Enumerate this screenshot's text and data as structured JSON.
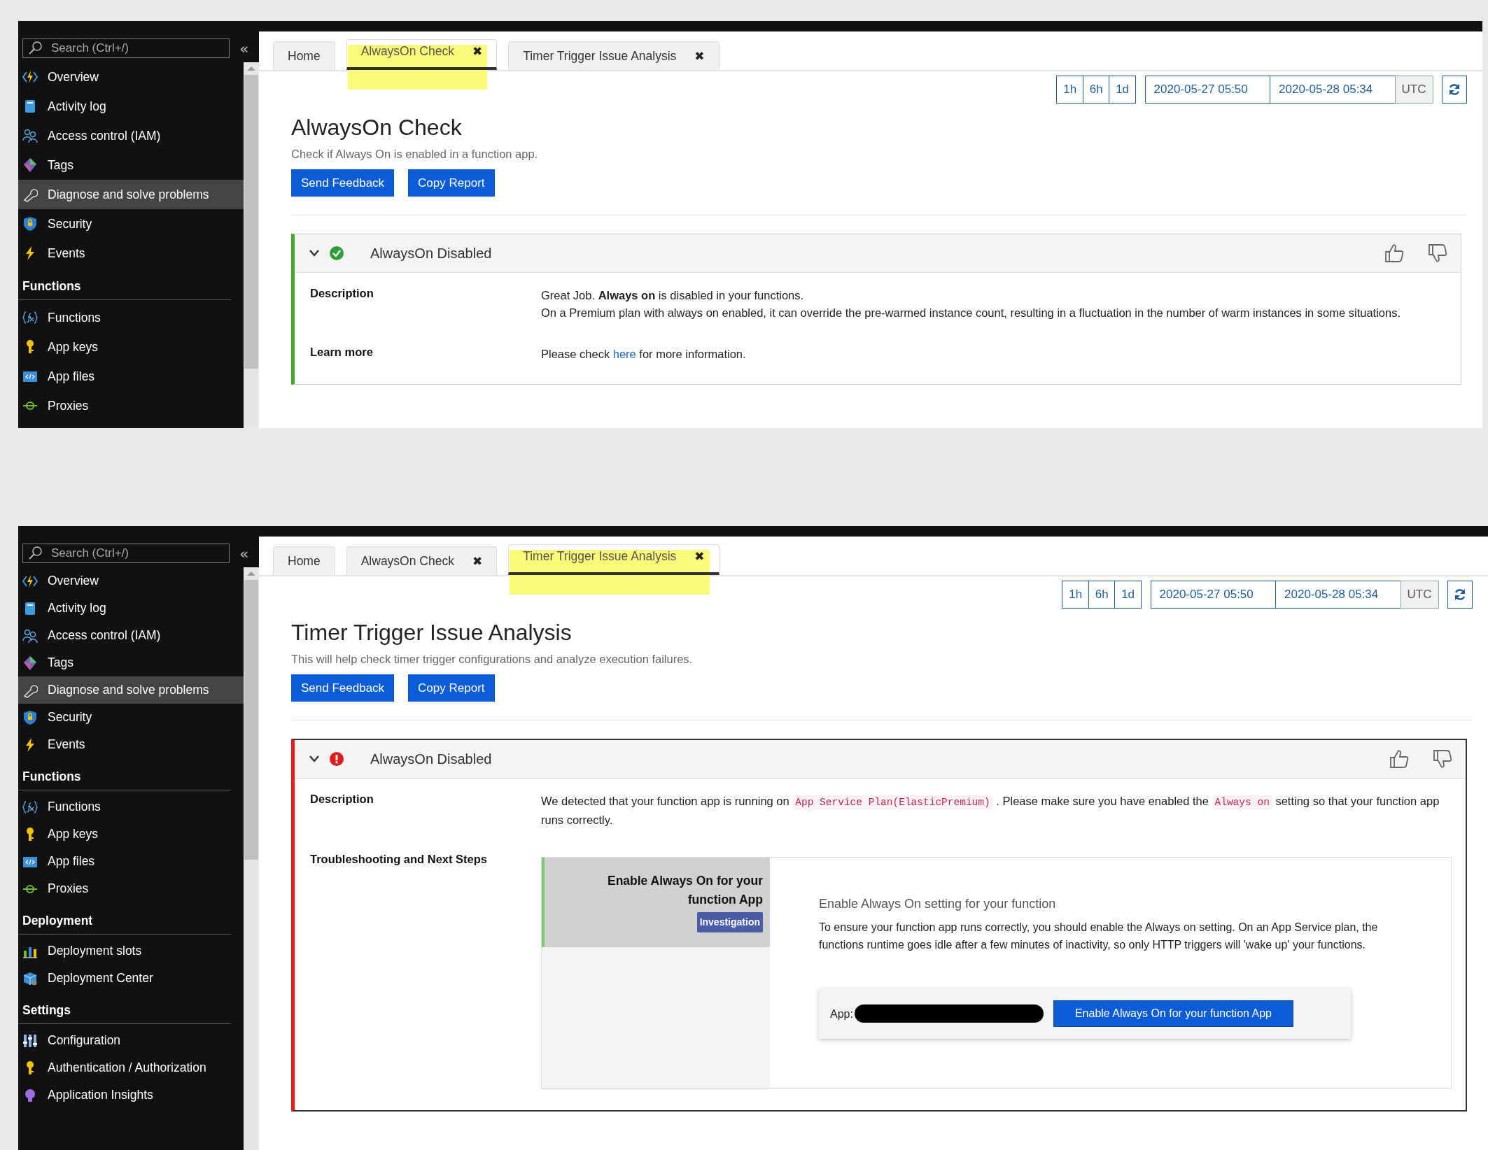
{
  "panels": [
    {
      "sidebar": {
        "search": {
          "placeholder": "Search (Ctrl+/)"
        },
        "collapse": "«",
        "items": [
          {
            "kind": "item",
            "label": "Overview",
            "selected": false
          },
          {
            "kind": "item",
            "label": "Activity log",
            "selected": false
          },
          {
            "kind": "item",
            "label": "Access control (IAM)",
            "selected": false
          },
          {
            "kind": "item",
            "label": "Tags",
            "selected": false
          },
          {
            "kind": "item",
            "label": "Diagnose and solve problems",
            "selected": true
          },
          {
            "kind": "item",
            "label": "Security",
            "selected": false
          },
          {
            "kind": "item",
            "label": "Events",
            "selected": false
          },
          {
            "kind": "heading",
            "label": "Functions"
          },
          {
            "kind": "item",
            "label": "Functions",
            "selected": false
          },
          {
            "kind": "item",
            "label": "App keys",
            "selected": false
          },
          {
            "kind": "item",
            "label": "App files",
            "selected": false
          },
          {
            "kind": "item",
            "label": "Proxies",
            "selected": false
          }
        ]
      },
      "tabs": [
        {
          "label": "Home",
          "selected": false,
          "highlighted": false
        },
        {
          "label": "AlwaysOn Check",
          "close": "✖",
          "selected": true,
          "highlighted": true
        },
        {
          "label": "Timer Trigger Issue Analysis",
          "close": "✖",
          "selected": false,
          "highlighted": false
        }
      ],
      "time_range": {
        "presets": [
          "1h",
          "6h",
          "1d"
        ],
        "start": "2020-05-27 05:50",
        "end": "2020-05-28 05:34",
        "timezone": "UTC"
      },
      "title": "AlwaysOn Check",
      "subtitle": "Check if Always On is enabled in a function app.",
      "buttons": [
        "Send Feedback",
        "Copy Report"
      ],
      "insight": {
        "kind": "success",
        "title": "AlwaysOn Disabled",
        "expanded": true,
        "rows": [
          {
            "kind": "text",
            "label": "Description",
            "lines": [
              [
                {
                  "kind": "text",
                  "text": "Great Job. **Always on** is disabled in your functions."
                }
              ],
              [
                {
                  "kind": "text",
                  "text": "On a Premium plan with always on enabled, it can override the pre-warmed instance count, resulting in a fluctuation in the number of warm instances in some situations."
                }
              ]
            ]
          },
          {
            "kind": "text",
            "label": "Learn more",
            "lines": [
              [
                {
                  "kind": "text",
                  "text": "Please check "
                },
                {
                  "kind": "link",
                  "text": "here"
                },
                {
                  "kind": "text",
                  "text": " for more information."
                }
              ]
            ]
          }
        ]
      }
    },
    {
      "sidebar": {
        "search": {
          "placeholder": "Search (Ctrl+/)"
        },
        "collapse": "«",
        "items": [
          {
            "kind": "item",
            "label": "Overview",
            "selected": false
          },
          {
            "kind": "item",
            "label": "Activity log",
            "selected": false
          },
          {
            "kind": "item",
            "label": "Access control (IAM)",
            "selected": false
          },
          {
            "kind": "item",
            "label": "Tags",
            "selected": false
          },
          {
            "kind": "item",
            "label": "Diagnose and solve problems",
            "selected": true
          },
          {
            "kind": "item",
            "label": "Security",
            "selected": false
          },
          {
            "kind": "item",
            "label": "Events",
            "selected": false
          },
          {
            "kind": "heading",
            "label": "Functions"
          },
          {
            "kind": "item",
            "label": "Functions",
            "selected": false
          },
          {
            "kind": "item",
            "label": "App keys",
            "selected": false
          },
          {
            "kind": "item",
            "label": "App files",
            "selected": false
          },
          {
            "kind": "item",
            "label": "Proxies",
            "selected": false
          },
          {
            "kind": "heading",
            "label": "Deployment"
          },
          {
            "kind": "item",
            "label": "Deployment slots",
            "selected": false
          },
          {
            "kind": "item",
            "label": "Deployment Center",
            "selected": false
          },
          {
            "kind": "heading",
            "label": "Settings"
          },
          {
            "kind": "item",
            "label": "Configuration",
            "selected": false
          },
          {
            "kind": "item",
            "label": "Authentication / Authorization",
            "selected": false
          },
          {
            "kind": "item",
            "label": "Application Insights",
            "selected": false
          }
        ]
      },
      "tabs": [
        {
          "label": "Home",
          "selected": false,
          "highlighted": false
        },
        {
          "label": "AlwaysOn Check",
          "close": "✖",
          "selected": false,
          "highlighted": false
        },
        {
          "label": "Timer Trigger Issue Analysis",
          "close": "✖",
          "selected": true,
          "highlighted": true
        }
      ],
      "time_range": {
        "presets": [
          "1h",
          "6h",
          "1d"
        ],
        "start": "2020-05-27 05:50",
        "end": "2020-05-28 05:34",
        "timezone": "UTC"
      },
      "title": "Timer Trigger Issue Analysis",
      "subtitle": "This will help check timer trigger configurations and analyze execution failures.",
      "buttons": [
        "Send Feedback",
        "Copy Report"
      ],
      "insight": {
        "kind": "critical",
        "title": "AlwaysOn Disabled",
        "expanded": true,
        "rows": [
          {
            "kind": "text",
            "label": "Description",
            "lines": [
              [
                {
                  "kind": "text",
                  "text": "We detected that your function app is running on "
                },
                {
                  "kind": "code",
                  "text": "App Service Plan(ElasticPremium)"
                },
                {
                  "kind": "text",
                  "text": " . Please make sure you have enabled the "
                },
                {
                  "kind": "code",
                  "text": "Always on"
                },
                {
                  "kind": "text",
                  "text": " setting so that your function app runs correctly."
                }
              ]
            ]
          },
          {
            "kind": "solutions",
            "label": "Troubleshooting and Next Steps",
            "solutions": [
              {
                "title": "Enable Always On for your function App",
                "badge": "Investigation",
                "selected": true,
                "heading": "Enable Always On setting for your function",
                "text": "To ensure your function app runs correctly, you should enable the Always on setting. On an App Service plan, the functions runtime goes idle after a few minutes of inactivity, so only HTTP triggers will 'wake up' your functions.",
                "action": {
                  "label": "App:",
                  "button": "Enable Always On for your function App"
                }
              }
            ]
          }
        ]
      }
    }
  ]
}
